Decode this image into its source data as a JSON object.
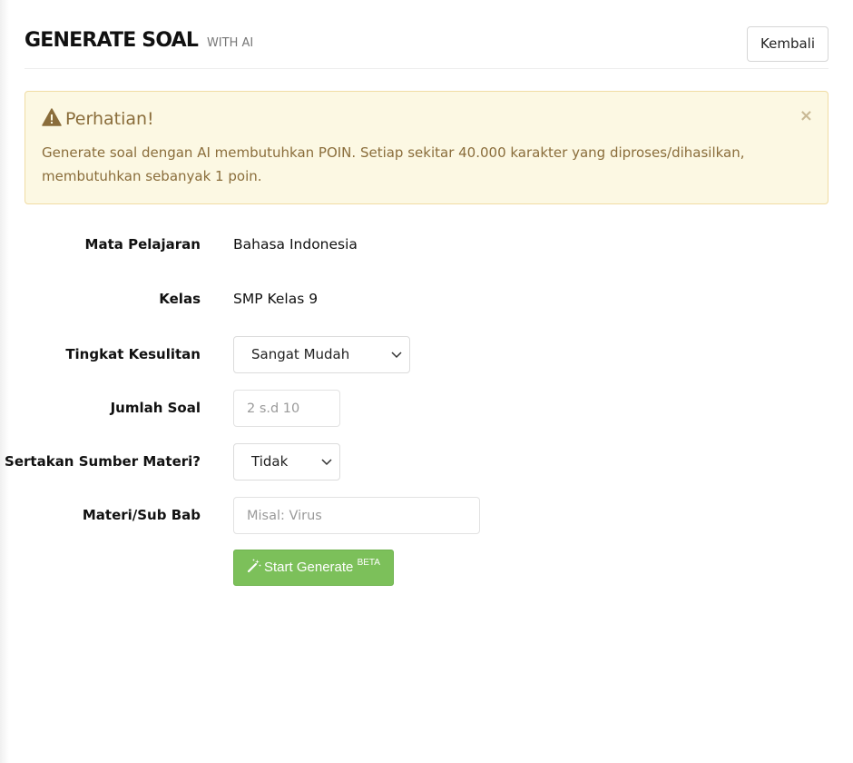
{
  "header": {
    "title": "GENERATE SOAL",
    "subtitle": "WITH AI",
    "back_label": "Kembali"
  },
  "alert": {
    "title": "Perhatian!",
    "message": "Generate soal dengan AI membutuhkan POIN. Setiap sekitar 40.000 karakter yang diproses/dihasilkan, membutuhkan sebanyak 1 poin.",
    "close_label": "×",
    "icon": "warning-icon"
  },
  "form": {
    "mata_pelajaran": {
      "label": "Mata Pelajaran",
      "value": "Bahasa Indonesia"
    },
    "kelas": {
      "label": "Kelas",
      "value": "SMP Kelas 9"
    },
    "tingkat_kesulitan": {
      "label": "Tingkat Kesulitan",
      "selected": "Sangat Mudah"
    },
    "jumlah_soal": {
      "label": "Jumlah Soal",
      "value": "",
      "placeholder": "2 s.d 10"
    },
    "sumber_materi": {
      "label": "Sertakan Sumber Materi?",
      "selected": "Tidak"
    },
    "materi": {
      "label": "Materi/Sub Bab",
      "value": "",
      "placeholder": "Misal: Virus"
    },
    "submit": {
      "label": "Start Generate",
      "badge": "BETA",
      "icon": "magic-wand-icon"
    }
  },
  "colors": {
    "alert_bg": "#fcf8e3",
    "alert_text": "#8a6d3b",
    "submit_bg": "#7cc05a"
  }
}
